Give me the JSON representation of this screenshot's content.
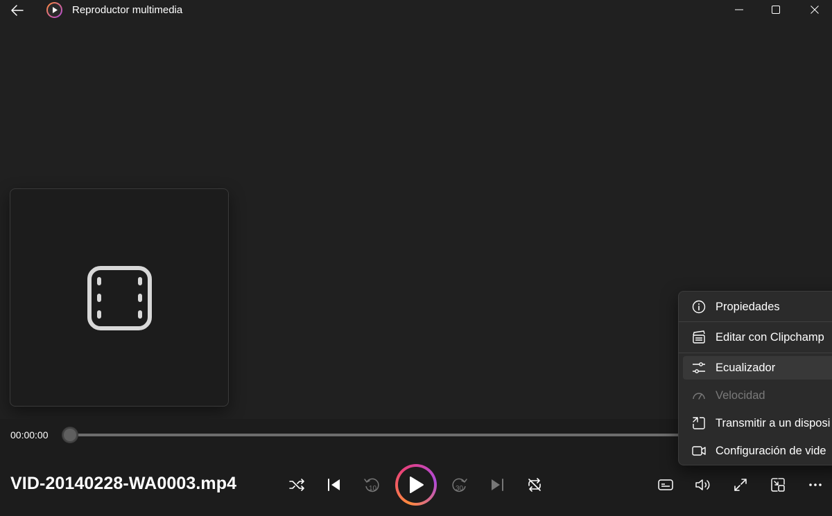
{
  "window": {
    "title": "Reproductor multimedia",
    "icons": {
      "back": "back-arrow-icon",
      "app": "media-player-icon",
      "minimize": "minimize-icon",
      "maximize": "maximize-icon",
      "close": "close-icon"
    }
  },
  "media": {
    "file_name": "VID-20140228-WA0003.mp4",
    "current_time": "00:00:00",
    "progress": 0,
    "thumbnail_icon": "film-icon"
  },
  "controls": {
    "shuffle_icon": "shuffle-icon",
    "previous_icon": "previous-track-icon",
    "rewind_label": "10",
    "play_icon": "play-icon",
    "forward_label": "30",
    "next_icon": "next-track-icon",
    "repeat_icon": "repeat-icon",
    "subtitles_icon": "subtitles-icon",
    "volume_icon": "volume-icon",
    "fullscreen_icon": "fullscreen-icon",
    "miniplayer_icon": "miniplayer-icon",
    "more_icon": "more-options-icon"
  },
  "menu": {
    "items": [
      {
        "label": "Propiedades",
        "icon": "info-icon",
        "disabled": false
      },
      {
        "label": "Editar con Clipchamp",
        "icon": "clapperboard-icon",
        "disabled": false
      },
      {
        "label": "Ecualizador",
        "icon": "equalizer-icon",
        "disabled": false
      },
      {
        "label": "Velocidad",
        "icon": "speed-icon",
        "disabled": true
      },
      {
        "label": "Transmitir a un disposi",
        "icon": "cast-icon",
        "disabled": false
      },
      {
        "label": "Configuración de vide",
        "icon": "video-settings-icon",
        "disabled": false
      }
    ]
  },
  "colors": {
    "background": "#202020",
    "menu_background": "#2b2b2b",
    "accent_start": "#ff8a3d",
    "accent_end": "#b04ad8",
    "disabled_text": "#7a7a7a"
  }
}
